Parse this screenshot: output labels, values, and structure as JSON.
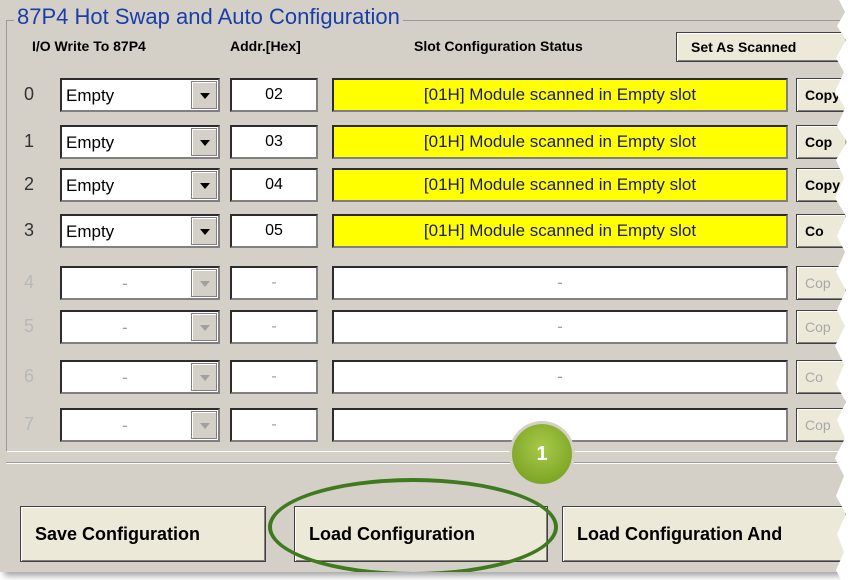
{
  "group": {
    "title": "87P4 Hot Swap and Auto Configuration"
  },
  "headers": {
    "io_write": "I/O Write To 87P4",
    "addr": "Addr.[Hex]",
    "status": "Slot Configuration Status",
    "set_as_scanned": "Set As Scanned"
  },
  "rows": [
    {
      "num": "0",
      "type": "Empty",
      "addr": "02",
      "status": "[01H] Module scanned in Empty slot",
      "copy": "Copy",
      "enabled": true
    },
    {
      "num": "1",
      "type": "Empty",
      "addr": "03",
      "status": "[01H] Module scanned in Empty slot",
      "copy": "Cop",
      "enabled": true
    },
    {
      "num": "2",
      "type": "Empty",
      "addr": "04",
      "status": "[01H] Module scanned in Empty slot",
      "copy": "Copy",
      "enabled": true
    },
    {
      "num": "3",
      "type": "Empty",
      "addr": "05",
      "status": "[01H] Module scanned in Empty slot",
      "copy": "Co",
      "enabled": true
    },
    {
      "num": "4",
      "type": "-",
      "addr": "-",
      "status": "-",
      "copy": "Cop",
      "enabled": false
    },
    {
      "num": "5",
      "type": "-",
      "addr": "-",
      "status": "-",
      "copy": "Cop",
      "enabled": false
    },
    {
      "num": "6",
      "type": "-",
      "addr": "-",
      "status": "-",
      "copy": "Co",
      "enabled": false
    },
    {
      "num": "7",
      "type": "-",
      "addr": "-",
      "status": "",
      "copy": "Cop",
      "enabled": false
    }
  ],
  "buttons": {
    "save": "Save Configuration",
    "load": "Load Configuration",
    "load_and": "Load  Configuration And"
  },
  "callout": {
    "number": "1"
  },
  "colors": {
    "panel": "#d4d0c8",
    "title": "#1a3ea8",
    "status_active": "#ffff00",
    "highlight_ring": "#3f7a1f",
    "callout": "#7fae22"
  }
}
